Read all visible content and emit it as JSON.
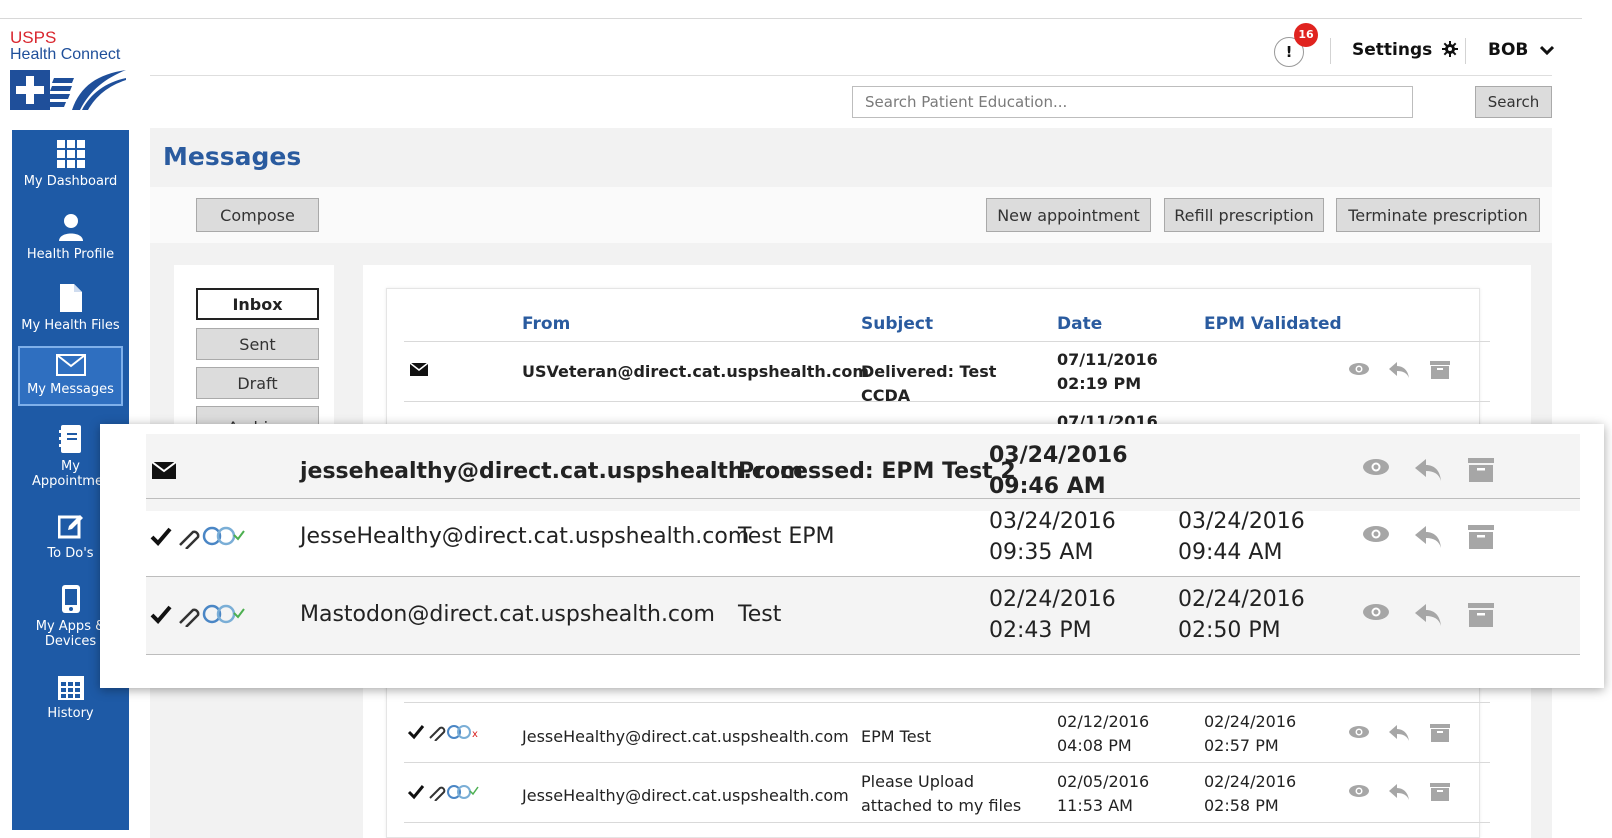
{
  "logo": {
    "line1": "USPS",
    "line2": "Health Connect"
  },
  "header": {
    "notification_symbol": "!",
    "notification_count": "16",
    "settings_label": "Settings",
    "user_label": "BOB"
  },
  "search": {
    "placeholder": "Search Patient Education...",
    "button_label": "Search"
  },
  "sidebar": {
    "items": [
      {
        "label": "My Dashboard",
        "icon": "grid-icon"
      },
      {
        "label": "Health Profile",
        "icon": "person-icon"
      },
      {
        "label": "My Health Files",
        "icon": "file-icon"
      },
      {
        "label": "My Messages",
        "icon": "envelope-icon",
        "active": true
      },
      {
        "label": "My Appointments",
        "label_line1": "My",
        "label_line2": "Appointmen",
        "icon": "address-book-icon"
      },
      {
        "label": "To Do's",
        "icon": "edit-icon"
      },
      {
        "label": "My Apps & Devices",
        "label_line1": "My Apps &",
        "label_line2": "Devices",
        "icon": "mobile-icon"
      },
      {
        "label": "History",
        "icon": "calendar-icon"
      }
    ]
  },
  "main": {
    "title": "Messages",
    "compose_label": "Compose",
    "actions": [
      "New appointment",
      "Refill prescription",
      "Terminate prescription"
    ],
    "folders": [
      "Inbox",
      "Sent",
      "Draft",
      "Archive"
    ]
  },
  "table": {
    "headers": {
      "from": "From",
      "subject": "Subject",
      "date": "Date",
      "epm": "EPM Validated"
    },
    "rows": [
      {
        "from": "USVeteran@direct.cat.uspshealth.com",
        "subject": "Delivered: Test CCDA",
        "date": "07/11/2016",
        "time": "02:19 PM",
        "epm_date": "",
        "epm_time": "",
        "unread": true
      },
      {
        "date": "07/11/2016"
      },
      {
        "from": "jessehealthy@direct.cat.uspshealth.com",
        "subject": "Processed: EPM Test 2",
        "date": "03/24/2016",
        "time": "09:46 AM",
        "epm_date": "",
        "epm_time": "",
        "unread": true
      },
      {
        "from": "JesseHealthy@direct.cat.uspshealth.com",
        "subject": "Test EPM",
        "date": "03/24/2016",
        "time": "09:35 AM",
        "epm_date": "03/24/2016",
        "epm_time": "09:44 AM",
        "unread": false
      },
      {
        "from": "Mastodon@direct.cat.uspshealth.com",
        "subject": "Test",
        "date": "02/24/2016",
        "time": "02:43 PM",
        "epm_date": "02/24/2016",
        "epm_time": "02:50 PM",
        "unread": false
      },
      {
        "from": "JesseHealthy@direct.cat.uspshealth.com",
        "subject": "EPM Test",
        "date": "02/12/2016",
        "time": "04:08 PM",
        "epm_date": "02/24/2016",
        "epm_time": "02:57 PM",
        "unread": false
      },
      {
        "from": "JesseHealthy@direct.cat.uspshealth.com",
        "subject": "Please Upload attached to my files",
        "subject_line1": "Please Upload",
        "subject_line2": "attached to my files",
        "date": "02/05/2016",
        "time": "11:53 AM",
        "epm_date": "02/24/2016",
        "epm_time": "02:58 PM",
        "unread": false
      }
    ]
  },
  "zoom_rows": [
    {
      "from": "jessehealthy@direct.cat.uspshealth.com",
      "subject": "Processed: EPM Test 2",
      "date": "03/24/2016",
      "time": "09:46 AM",
      "epm_date": "",
      "epm_time": "",
      "unread": true
    },
    {
      "from": "JesseHealthy@direct.cat.uspshealth.com",
      "subject": "Test EPM",
      "date": "03/24/2016",
      "time": "09:35 AM",
      "epm_date": "03/24/2016",
      "epm_time": "09:44 AM",
      "unread": false
    },
    {
      "from": "Mastodon@direct.cat.uspshealth.com",
      "subject": "Test",
      "date": "02/24/2016",
      "time": "02:43 PM",
      "epm_date": "02/24/2016",
      "epm_time": "02:50 PM",
      "unread": false
    }
  ],
  "partial_behind_zoom": {
    "time": "02:43 PM",
    "epm_time": "02:50 PM"
  },
  "colors": {
    "sidebar": "#1e5aa6",
    "accent": "#2a5b9f",
    "badge": "#e0231f",
    "logo_red": "#d9262e"
  }
}
